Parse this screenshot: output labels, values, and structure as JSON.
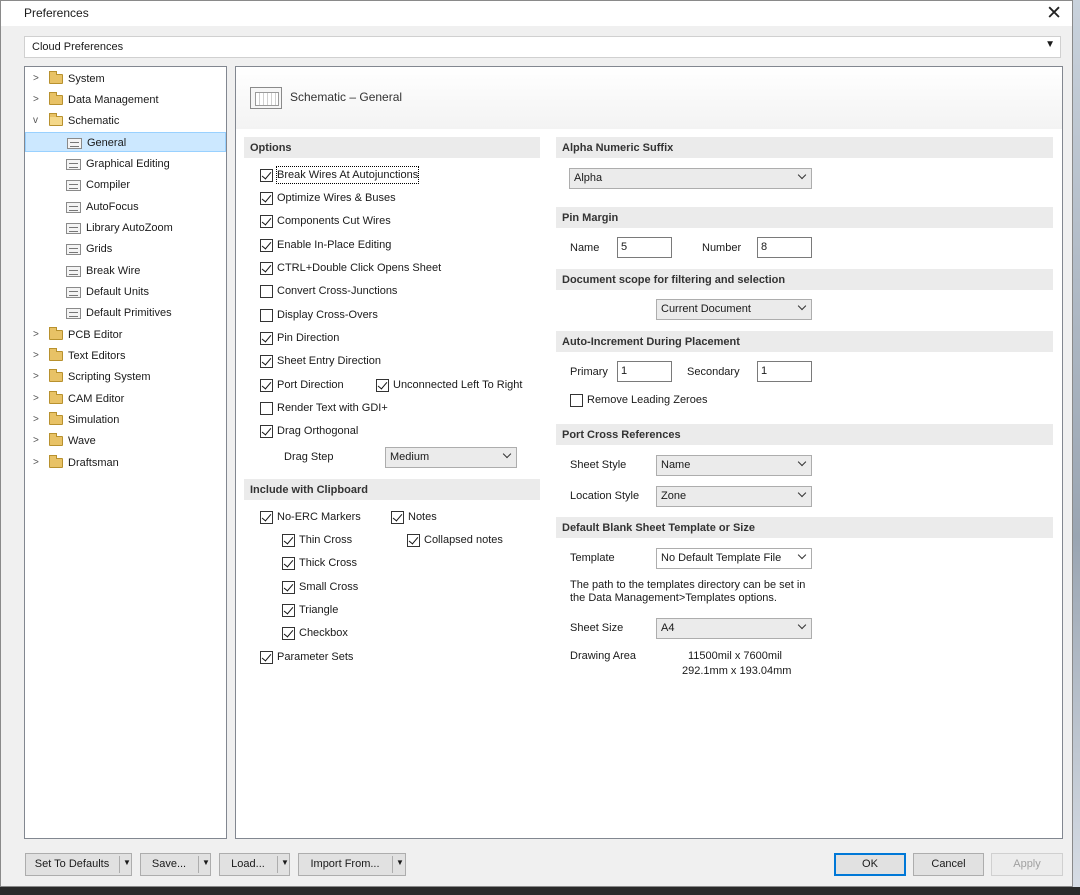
{
  "window": {
    "title": "Preferences"
  },
  "cloud": {
    "value": "Cloud Preferences"
  },
  "tree": {
    "items": [
      {
        "label": "System"
      },
      {
        "label": "Data Management"
      },
      {
        "label": "Schematic"
      },
      {
        "label": "General"
      },
      {
        "label": "Graphical Editing"
      },
      {
        "label": "Compiler"
      },
      {
        "label": "AutoFocus"
      },
      {
        "label": "Library AutoZoom"
      },
      {
        "label": "Grids"
      },
      {
        "label": "Break Wire"
      },
      {
        "label": "Default Units"
      },
      {
        "label": "Default Primitives"
      },
      {
        "label": "PCB Editor"
      },
      {
        "label": "Text Editors"
      },
      {
        "label": "Scripting System"
      },
      {
        "label": "CAM Editor"
      },
      {
        "label": "Simulation"
      },
      {
        "label": "Wave"
      },
      {
        "label": "Draftsman"
      }
    ]
  },
  "panel": {
    "title": "Schematic – General"
  },
  "options": {
    "header": "Options",
    "items": [
      {
        "label": "Break Wires At Autojunctions",
        "checked": true
      },
      {
        "label": "Optimize Wires & Buses",
        "checked": true
      },
      {
        "label": "Components Cut Wires",
        "checked": true
      },
      {
        "label": "Enable In-Place Editing",
        "checked": true
      },
      {
        "label": "CTRL+Double Click Opens Sheet",
        "checked": true
      },
      {
        "label": "Convert Cross-Junctions",
        "checked": false
      },
      {
        "label": "Display Cross-Overs",
        "checked": false
      },
      {
        "label": "Pin Direction",
        "checked": true
      },
      {
        "label": "Sheet Entry Direction",
        "checked": true
      },
      {
        "label": "Port Direction",
        "checked": true
      },
      {
        "label": "Unconnected Left To Right",
        "checked": true
      },
      {
        "label": "Render Text with GDI+",
        "checked": false
      },
      {
        "label": "Drag Orthogonal",
        "checked": true
      }
    ],
    "drag_step_label": "Drag Step",
    "drag_step_value": "Medium"
  },
  "clipboard": {
    "header": "Include with Clipboard",
    "items": [
      {
        "label": "No-ERC Markers",
        "checked": true
      },
      {
        "label": "Notes",
        "checked": true
      },
      {
        "label": "Thin Cross",
        "checked": true
      },
      {
        "label": "Collapsed notes",
        "checked": true
      },
      {
        "label": "Thick Cross",
        "checked": true
      },
      {
        "label": "Small Cross",
        "checked": true
      },
      {
        "label": "Triangle",
        "checked": true
      },
      {
        "label": "Checkbox",
        "checked": true
      },
      {
        "label": "Parameter Sets",
        "checked": true
      }
    ]
  },
  "alpha": {
    "header": "Alpha Numeric Suffix",
    "value": "Alpha"
  },
  "pin_margin": {
    "header": "Pin Margin",
    "name_label": "Name",
    "name_value": "5",
    "number_label": "Number",
    "number_value": "8"
  },
  "doc_scope": {
    "header": "Document scope for filtering and selection",
    "value": "Current Document"
  },
  "auto_inc": {
    "header": "Auto-Increment During Placement",
    "primary_label": "Primary",
    "primary_value": "1",
    "secondary_label": "Secondary",
    "secondary_value": "1",
    "remove_zeroes": "Remove Leading Zeroes",
    "remove_zeroes_checked": false
  },
  "port_xref": {
    "header": "Port Cross References",
    "sheet_style_label": "Sheet Style",
    "sheet_style_value": "Name",
    "location_style_label": "Location Style",
    "location_style_value": "Zone"
  },
  "template": {
    "header": "Default Blank Sheet Template or Size",
    "template_label": "Template",
    "template_value": "No Default Template File",
    "info_line1": "The path to the templates directory can be set in",
    "info_line2": "the Data Management>Templates options.",
    "sheet_size_label": "Sheet Size",
    "sheet_size_value": "A4",
    "drawing_area_label": "Drawing Area",
    "drawing_area_mil": "11500mil x 7600mil",
    "drawing_area_mm": "292.1mm x 193.04mm"
  },
  "footer": {
    "set_defaults": "Set To Defaults",
    "save": "Save...",
    "load": "Load...",
    "import": "Import From...",
    "ok": "OK",
    "cancel": "Cancel",
    "apply": "Apply"
  }
}
